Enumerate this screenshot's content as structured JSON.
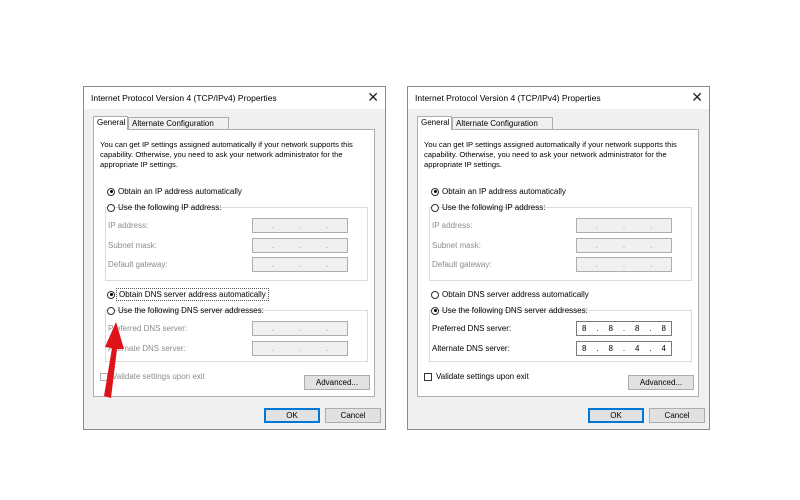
{
  "dialog_title": "Internet Protocol Version 4 (TCP/IPv4) Properties",
  "close_glyph": "✕",
  "tabs": [
    "General",
    "Alternate Configuration"
  ],
  "intro_text": "You can get IP settings assigned automatically if your network supports this capability. Otherwise, you need to ask your network administrator for the appropriate IP settings.",
  "labels": {
    "obtain_ip": "Obtain an IP address automatically",
    "use_ip": "Use the following IP address:",
    "ip_address": "IP address:",
    "subnet_mask": "Subnet mask:",
    "default_gateway": "Default gateway:",
    "obtain_dns": "Obtain DNS server address automatically",
    "use_dns": "Use the following DNS server addresses:",
    "preferred_dns": "Preferred DNS server:",
    "alternate_dns": "Alternate DNS server:",
    "validate": "Validate settings upon exit",
    "advanced": "Advanced...",
    "ok": "OK",
    "cancel": "Cancel"
  },
  "left": {
    "ip_mode": "auto",
    "dns_mode": "auto",
    "preferred_dns": [
      "",
      "",
      "",
      ""
    ],
    "alternate_dns": [
      "",
      "",
      "",
      ""
    ]
  },
  "right": {
    "ip_mode": "auto",
    "dns_mode": "manual",
    "preferred_dns": [
      "8",
      "8",
      "8",
      "8"
    ],
    "alternate_dns": [
      "8",
      "8",
      "4",
      "4"
    ]
  },
  "annotation": {
    "type": "arrow",
    "color": "#e0121a"
  }
}
